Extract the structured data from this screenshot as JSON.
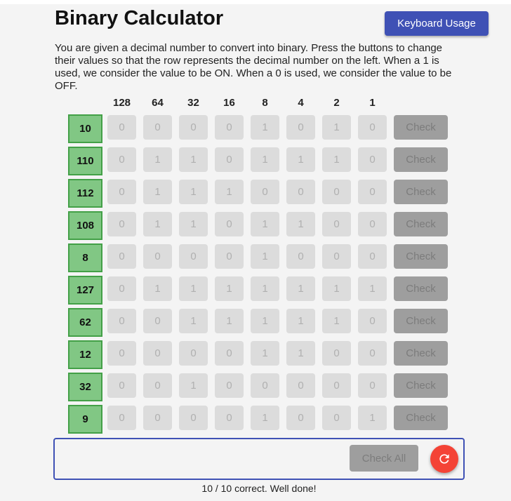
{
  "header": {
    "title": "Binary Calculator",
    "keyboard_button": "Keyboard Usage"
  },
  "description": "You are given a decimal number to convert into binary. Press the buttons to change their values so that the row represents the decimal number on the left. When a 1 is used, we consider the value to be ON. When a 0 is used, we consider the value to be OFF.",
  "bit_headers": [
    "128",
    "64",
    "32",
    "16",
    "8",
    "4",
    "2",
    "1"
  ],
  "check_label": "Check",
  "rows": [
    {
      "decimal": "10",
      "bits": [
        "0",
        "0",
        "0",
        "0",
        "1",
        "0",
        "1",
        "0"
      ]
    },
    {
      "decimal": "110",
      "bits": [
        "0",
        "1",
        "1",
        "0",
        "1",
        "1",
        "1",
        "0"
      ]
    },
    {
      "decimal": "112",
      "bits": [
        "0",
        "1",
        "1",
        "1",
        "0",
        "0",
        "0",
        "0"
      ]
    },
    {
      "decimal": "108",
      "bits": [
        "0",
        "1",
        "1",
        "0",
        "1",
        "1",
        "0",
        "0"
      ]
    },
    {
      "decimal": "8",
      "bits": [
        "0",
        "0",
        "0",
        "0",
        "1",
        "0",
        "0",
        "0"
      ]
    },
    {
      "decimal": "127",
      "bits": [
        "0",
        "1",
        "1",
        "1",
        "1",
        "1",
        "1",
        "1"
      ]
    },
    {
      "decimal": "62",
      "bits": [
        "0",
        "0",
        "1",
        "1",
        "1",
        "1",
        "1",
        "0"
      ]
    },
    {
      "decimal": "12",
      "bits": [
        "0",
        "0",
        "0",
        "0",
        "1",
        "1",
        "0",
        "0"
      ]
    },
    {
      "decimal": "32",
      "bits": [
        "0",
        "0",
        "1",
        "0",
        "0",
        "0",
        "0",
        "0"
      ]
    },
    {
      "decimal": "9",
      "bits": [
        "0",
        "0",
        "0",
        "0",
        "1",
        "0",
        "0",
        "1"
      ]
    }
  ],
  "footer": {
    "check_all": "Check All",
    "reset_icon": "refresh-icon",
    "status": "10 / 10 correct. Well done!"
  },
  "colors": {
    "primary": "#3f51b5",
    "decimal_bg": "#81c784",
    "decimal_border": "#43a047",
    "reset": "#f44336",
    "disabled_button": "#9e9e9e",
    "bit_button": "#dcdcdc"
  }
}
